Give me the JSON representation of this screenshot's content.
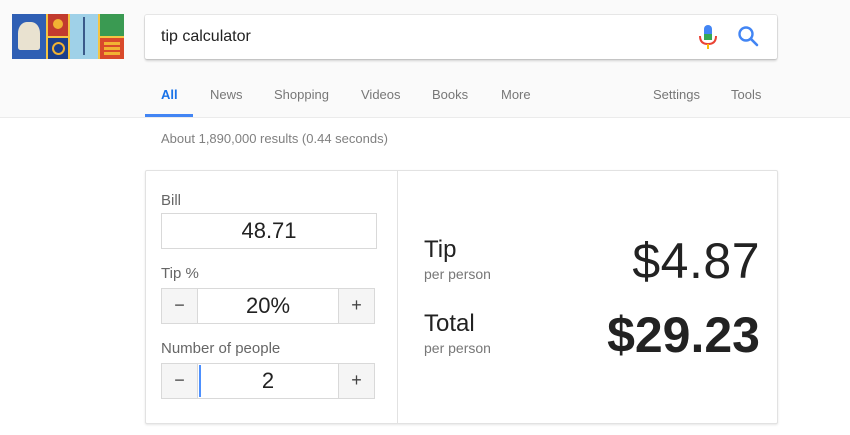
{
  "search": {
    "query": "tip calculator"
  },
  "tabs": [
    {
      "label": "All",
      "active": true
    },
    {
      "label": "News"
    },
    {
      "label": "Shopping"
    },
    {
      "label": "Videos"
    },
    {
      "label": "Books"
    },
    {
      "label": "More"
    },
    {
      "label": "Settings"
    },
    {
      "label": "Tools"
    }
  ],
  "result_stats": "About 1,890,000 results (0.44 seconds)",
  "calculator": {
    "bill_label": "Bill",
    "bill_value": "48.71",
    "tip_label": "Tip %",
    "tip_value": "20%",
    "people_label": "Number of people",
    "people_value": "2",
    "minus": "−",
    "plus": "+"
  },
  "output": {
    "tip_title": "Tip",
    "tip_sub": "per person",
    "tip_amount": "$4.87",
    "total_title": "Total",
    "total_sub": "per person",
    "total_amount": "$29.23"
  },
  "colors": {
    "accent": "#4285f4",
    "active_tab": "#1a73e8"
  },
  "icons": [
    "doodle-logo",
    "microphone-icon",
    "search-icon"
  ]
}
